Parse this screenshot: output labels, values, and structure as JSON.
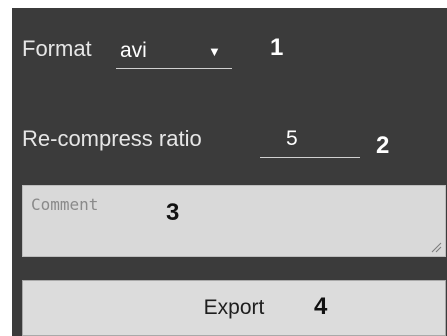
{
  "format": {
    "label": "Format",
    "selected": "avi",
    "arrow_icon": "dropdown-arrow-icon"
  },
  "recompress": {
    "label": "Re-compress ratio",
    "value": "5"
  },
  "comment": {
    "placeholder": "Comment",
    "value": ""
  },
  "export": {
    "label": "Export"
  },
  "callouts": {
    "format": "1",
    "ratio": "2",
    "comment": "3",
    "export": "4"
  },
  "colors": {
    "panel_background": "#3b3b3b",
    "text_light": "#e6e6e6",
    "comment_background": "#d9d9d9",
    "button_background": "#dcdcdc"
  }
}
